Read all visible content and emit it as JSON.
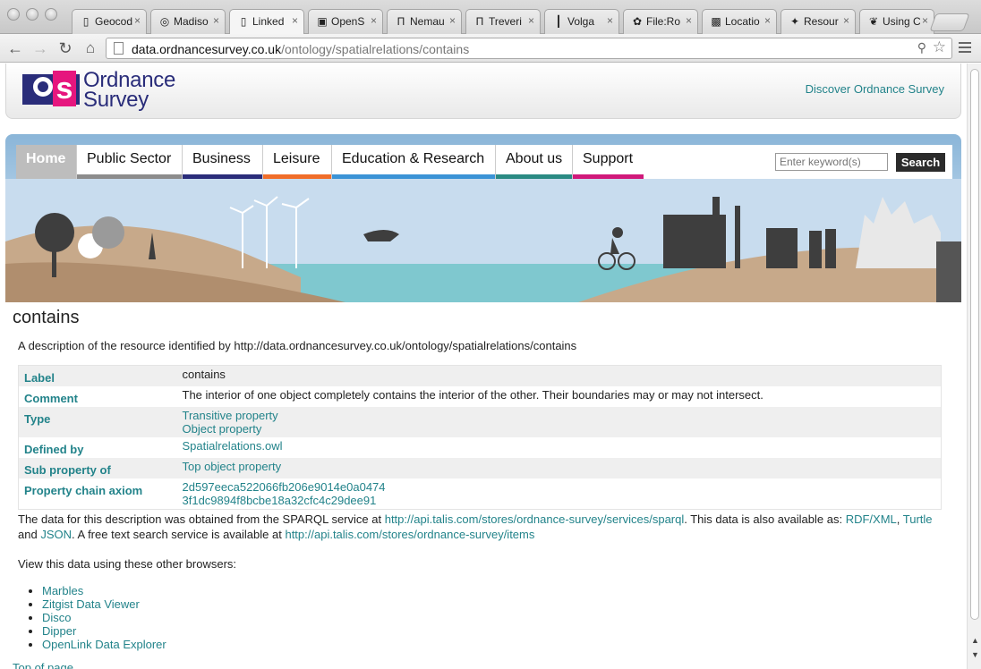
{
  "browser": {
    "tabs": [
      {
        "title": "Geocod",
        "icon": "page-icon"
      },
      {
        "title": "Madiso",
        "icon": "globe-icon"
      },
      {
        "title": "Linked",
        "icon": "page-icon",
        "active": true
      },
      {
        "title": "OpenS",
        "icon": "map-icon"
      },
      {
        "title": "Nemau",
        "icon": "pi-icon"
      },
      {
        "title": "Treveri",
        "icon": "pi-icon"
      },
      {
        "title": "Volga",
        "icon": "bars-icon"
      },
      {
        "title": "File:Ro",
        "icon": "wiki-icon"
      },
      {
        "title": "Locatio",
        "icon": "maps-icon"
      },
      {
        "title": "Resour",
        "icon": "star-burst-icon"
      },
      {
        "title": "Using C",
        "icon": "leaf-icon"
      }
    ],
    "url_host": "data.ordnancesurvey.co.uk",
    "url_path": "/ontology/spatialrelations/contains"
  },
  "header": {
    "brand_line1": "Ordnance",
    "brand_line2": "Survey",
    "discover_link": "Discover Ordnance Survey"
  },
  "nav": {
    "items": [
      {
        "label": "Home",
        "color": "#bdbdbd"
      },
      {
        "label": "Public Sector",
        "color": "#8c8c8c"
      },
      {
        "label": "Business",
        "color": "#2a2d7a"
      },
      {
        "label": "Leisure",
        "color": "#f06e2a"
      },
      {
        "label": "Education & Research",
        "color": "#3b93d6"
      },
      {
        "label": "About us",
        "color": "#2a8a83"
      },
      {
        "label": "Support",
        "color": "#d0197a"
      }
    ],
    "search_placeholder": "Enter keyword(s)",
    "search_button": "Search"
  },
  "main": {
    "title": "contains",
    "desc_prefix": "A description of the resource identified by",
    "resource_uri": "http://data.ordnancesurvey.co.uk/ontology/spatialrelations/contains",
    "props": [
      {
        "key": "Label",
        "values": [
          "contains"
        ],
        "link": false
      },
      {
        "key": "Comment",
        "values": [
          "The interior of one object completely contains the interior of the other. Their boundaries may or may not intersect."
        ],
        "link": false
      },
      {
        "key": "Type",
        "values": [
          "Transitive property",
          "Object property"
        ],
        "link": true
      },
      {
        "key": "Defined by",
        "values": [
          "Spatialrelations.owl"
        ],
        "link": true
      },
      {
        "key": "Sub property of",
        "values": [
          "Top object property"
        ],
        "link": true
      },
      {
        "key": "Property chain axiom",
        "values": [
          "2d597eeca522066fb206e9014e0a0474",
          "3f1dc9894f8bcbe18a32cfc4c29dee91"
        ],
        "link": true
      }
    ],
    "source": {
      "text1": "The data for this description was obtained from the SPARQL service at",
      "sparql_url": "http://api.talis.com/stores/ordnance-survey/services/sparql",
      "text2": ". This data is also available as:",
      "rdfxml": "RDF/XML",
      "sep1": ",",
      "turtle": "Turtle",
      "text3": "and",
      "json": "JSON",
      "text4": ". A free text search service is available at",
      "items_url": "http://api.talis.com/stores/ordnance-survey/items"
    },
    "browsers_intro": "View this data using these other browsers:",
    "browsers": [
      "Marbles",
      "Zitgist Data Viewer",
      "Disco",
      "Dipper",
      "OpenLink Data Explorer"
    ],
    "top_link": "Top of page"
  }
}
